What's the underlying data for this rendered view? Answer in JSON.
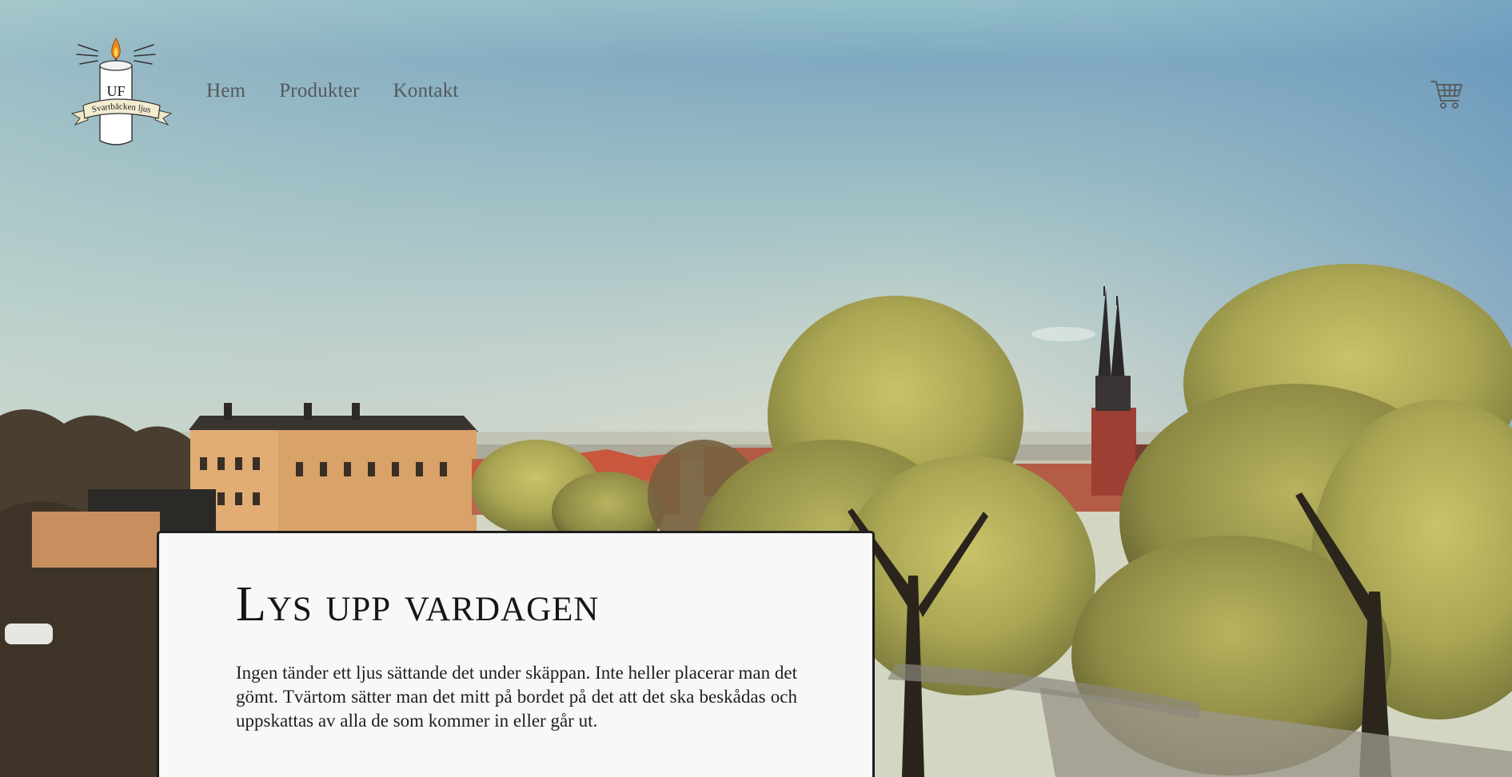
{
  "brand": {
    "logo_top_text": "UF",
    "logo_ribbon_text": "Svartbäcken ljus"
  },
  "nav": {
    "items": [
      {
        "label": "Hem"
      },
      {
        "label": "Produkter"
      },
      {
        "label": "Kontakt"
      }
    ]
  },
  "header": {
    "cart_icon": "shopping-cart-icon"
  },
  "hero": {
    "title": "Lys upp vardagen",
    "body": "Ingen tänder ett ljus sättande det under skäppan. Inte heller placerar man det gömt. Tvärtom sätter man det mitt på bordet på det att det ska beskådas och uppskattas av alla de som kommer in eller går ut."
  },
  "colors": {
    "sky_top": "#7fa9c0",
    "card_bg": "#f8f8f8",
    "card_border": "#1d1d1d",
    "nav_text": "#55585a"
  }
}
